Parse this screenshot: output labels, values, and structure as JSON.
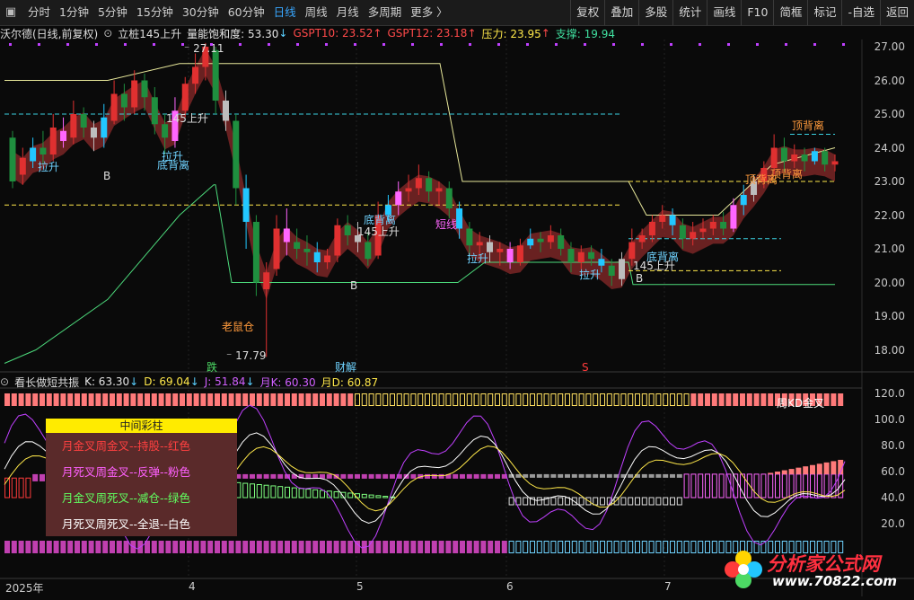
{
  "toolbar": {
    "left_tabs": [
      {
        "label": "分时",
        "active": false
      },
      {
        "label": "1分钟",
        "active": false
      },
      {
        "label": "5分钟",
        "active": false
      },
      {
        "label": "15分钟",
        "active": false
      },
      {
        "label": "30分钟",
        "active": false
      },
      {
        "label": "60分钟",
        "active": false
      },
      {
        "label": "日线",
        "active": true
      },
      {
        "label": "周线",
        "active": false
      },
      {
        "label": "月线",
        "active": false
      },
      {
        "label": "多周期",
        "active": false
      },
      {
        "label": "更多 〉",
        "active": false
      }
    ],
    "right_buttons": [
      "复权",
      "叠加",
      "多股",
      "统计",
      "画线",
      "F10",
      "简框",
      "标记",
      "-自选",
      "返回"
    ]
  },
  "info": {
    "stock": "沃尔德(日线,前复权)",
    "indicator": "立桩145上升",
    "vol_sat": "量能饱和度: 53.30",
    "gspt10": "GSPT10: 23.52",
    "gspt12": "GSPT12: 23.18",
    "pressure": "压力: 23.95",
    "support": "支撑: 19.94"
  },
  "info2": {
    "name": "看长做短共振",
    "k": "K: 63.30",
    "d": "D: 69.04",
    "j": "J: 51.84",
    "mk": "月K: 60.30",
    "md": "月D: 60.87"
  },
  "price_axis": [
    "27.00",
    "26.00",
    "25.00",
    "24.00",
    "23.00",
    "22.00",
    "21.00",
    "20.00",
    "19.00",
    "18.00"
  ],
  "osc_axis": [
    "120.0",
    "100.0",
    "80.0",
    "60.0",
    "40.0",
    "20.0"
  ],
  "x_axis": [
    "2025年",
    "4",
    "5",
    "6",
    "7"
  ],
  "annotations": {
    "high": "27.11",
    "low": "17.79",
    "a1": "拉升",
    "a2": "B",
    "a3": "底背离",
    "a4": "145上升",
    "a5": "老鼠仓",
    "a6": "跌",
    "a7": "财解",
    "a8": "拉升",
    "a9": "B",
    "a10": "底背离",
    "a11": "短线",
    "a12": "拉升",
    "a13": "拉升",
    "a14": "底背离",
    "a15": "145上升",
    "a16": "B",
    "a17": "顶背离",
    "a18": "顶背离",
    "a19": "顶背离",
    "a20": "S",
    "a21": "周KD金叉",
    "a22": "145上升"
  },
  "legend": {
    "title": "中间彩柱",
    "rows": [
      {
        "text": "月金叉周金叉--持股--红色",
        "color": "#ff4040"
      },
      {
        "text": "月死叉周金叉--反弹--粉色",
        "color": "#ff60ff"
      },
      {
        "text": "月金叉周死叉--减仓--绿色",
        "color": "#60ff60"
      },
      {
        "text": "月死叉周死叉--全退--白色",
        "color": "#ffffff"
      }
    ]
  },
  "watermark": {
    "line1": "分析家公式网",
    "line2": "www.70822.com"
  },
  "chart_data": {
    "type": "candlestick",
    "ylim": [
      17.5,
      27.5
    ],
    "candles": [
      [
        24.3,
        23.0,
        24.5,
        22.8
      ],
      [
        23.2,
        23.7,
        24.0,
        22.9
      ],
      [
        23.6,
        24.0,
        24.3,
        23.4
      ],
      [
        24.0,
        23.8,
        24.5,
        23.5
      ],
      [
        23.8,
        24.6,
        25.0,
        23.6
      ],
      [
        24.5,
        24.2,
        24.9,
        24.0
      ],
      [
        24.3,
        25.0,
        25.4,
        24.1
      ],
      [
        25.0,
        24.6,
        25.2,
        24.3
      ],
      [
        24.6,
        24.3,
        24.8,
        23.9
      ],
      [
        24.3,
        24.9,
        25.3,
        24.0
      ],
      [
        24.8,
        25.6,
        26.0,
        24.7
      ],
      [
        25.6,
        25.2,
        25.9,
        24.8
      ],
      [
        25.2,
        26.0,
        26.3,
        25.0
      ],
      [
        26.0,
        25.5,
        26.2,
        25.1
      ],
      [
        25.5,
        24.7,
        25.8,
        24.4
      ],
      [
        24.7,
        24.3,
        25.0,
        23.8
      ],
      [
        24.2,
        25.1,
        25.5,
        24.0
      ],
      [
        25.1,
        25.9,
        26.1,
        24.9
      ],
      [
        25.9,
        26.4,
        26.8,
        25.6
      ],
      [
        26.4,
        27.0,
        27.11,
        26.0
      ],
      [
        26.9,
        25.4,
        27.0,
        25.0
      ],
      [
        25.4,
        24.8,
        25.7,
        24.5
      ],
      [
        24.8,
        22.8,
        25.0,
        22.3
      ],
      [
        22.8,
        21.8,
        23.2,
        21.0
      ],
      [
        21.8,
        20.0,
        22.0,
        19.6
      ],
      [
        19.8,
        20.3,
        20.6,
        17.79
      ],
      [
        20.4,
        21.6,
        22.0,
        20.2
      ],
      [
        21.6,
        21.2,
        22.2,
        20.8
      ],
      [
        21.2,
        21.0,
        21.6,
        20.7
      ],
      [
        21.0,
        20.9,
        21.4,
        20.5
      ],
      [
        20.9,
        20.6,
        21.2,
        20.3
      ],
      [
        20.6,
        20.8,
        21.0,
        20.4
      ],
      [
        20.8,
        21.7,
        21.9,
        20.6
      ],
      [
        21.7,
        21.4,
        22.0,
        21.1
      ],
      [
        21.4,
        21.2,
        21.8,
        20.9
      ],
      [
        21.2,
        20.7,
        21.5,
        20.5
      ],
      [
        20.8,
        22.0,
        22.4,
        20.7
      ],
      [
        22.0,
        22.3,
        22.6,
        21.8
      ],
      [
        22.3,
        22.7,
        23.0,
        22.0
      ],
      [
        22.7,
        22.8,
        23.2,
        22.4
      ],
      [
        22.8,
        23.1,
        23.5,
        22.6
      ],
      [
        23.1,
        22.7,
        23.3,
        22.4
      ],
      [
        22.7,
        22.8,
        23.0,
        22.3
      ],
      [
        22.8,
        22.2,
        23.0,
        21.9
      ],
      [
        22.2,
        21.6,
        22.4,
        21.3
      ],
      [
        21.6,
        21.1,
        21.8,
        20.8
      ],
      [
        21.1,
        21.2,
        21.5,
        20.7
      ],
      [
        21.2,
        20.9,
        21.4,
        20.6
      ],
      [
        20.9,
        21.0,
        21.2,
        20.5
      ],
      [
        21.0,
        20.6,
        21.2,
        20.4
      ],
      [
        20.6,
        21.1,
        21.3,
        20.5
      ],
      [
        21.1,
        21.3,
        21.6,
        21.0
      ],
      [
        21.3,
        21.2,
        21.5,
        20.9
      ],
      [
        21.2,
        21.4,
        21.7,
        21.0
      ],
      [
        21.4,
        21.0,
        21.6,
        20.8
      ],
      [
        21.0,
        20.6,
        21.2,
        20.3
      ],
      [
        20.6,
        20.9,
        21.1,
        20.4
      ],
      [
        20.9,
        20.7,
        21.1,
        20.5
      ],
      [
        20.7,
        20.5,
        21.0,
        20.3
      ],
      [
        20.5,
        20.2,
        20.7,
        19.9
      ],
      [
        20.1,
        20.7,
        20.9,
        19.9
      ],
      [
        20.7,
        21.2,
        21.6,
        20.5
      ],
      [
        21.2,
        21.4,
        21.6,
        21.0
      ],
      [
        21.4,
        21.8,
        22.0,
        21.2
      ],
      [
        21.8,
        22.0,
        22.3,
        21.6
      ],
      [
        22.0,
        21.7,
        22.2,
        21.4
      ],
      [
        21.7,
        21.3,
        21.9,
        21.0
      ],
      [
        21.3,
        21.5,
        21.8,
        21.1
      ],
      [
        21.5,
        21.6,
        21.9,
        21.3
      ],
      [
        21.6,
        21.8,
        22.0,
        21.4
      ],
      [
        21.8,
        21.6,
        22.1,
        21.4
      ],
      [
        21.6,
        22.3,
        22.5,
        21.5
      ],
      [
        22.3,
        22.6,
        22.9,
        22.0
      ],
      [
        22.6,
        23.0,
        23.2,
        22.4
      ],
      [
        23.0,
        23.4,
        23.6,
        22.8
      ],
      [
        23.4,
        24.0,
        24.4,
        23.2
      ],
      [
        24.0,
        23.6,
        24.3,
        23.3
      ],
      [
        23.6,
        23.8,
        24.1,
        23.4
      ],
      [
        23.8,
        23.6,
        24.0,
        23.3
      ],
      [
        23.6,
        23.9,
        24.0,
        23.5
      ],
      [
        23.9,
        23.5,
        24.0,
        23.3
      ],
      [
        23.5,
        23.6,
        23.8,
        23.3
      ]
    ],
    "lines": {
      "pressure": "yellow step line",
      "support": "green step line"
    }
  }
}
